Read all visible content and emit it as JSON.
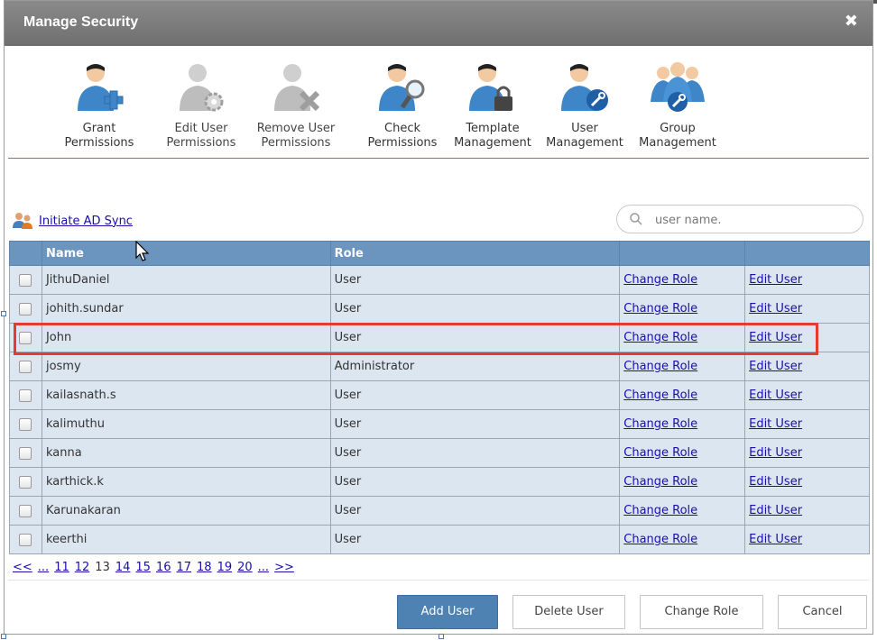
{
  "dialog": {
    "title": "Manage Security",
    "close_icon": "close-icon"
  },
  "toolbar": {
    "items": [
      {
        "label1": "Grant",
        "label2": "Permissions",
        "icon": "user-add-icon"
      },
      {
        "label1": "Edit User",
        "label2": "Permissions",
        "icon": "user-gear-icon"
      },
      {
        "label1": "Remove User",
        "label2": "Permissions",
        "icon": "user-remove-icon"
      },
      {
        "label1": "Check",
        "label2": "Permissions",
        "icon": "user-search-icon"
      },
      {
        "label1": "Template",
        "label2": "Management",
        "icon": "user-lock-icon"
      },
      {
        "label1": "User",
        "label2": "Management",
        "icon": "user-wrench-icon"
      },
      {
        "label1": "Group",
        "label2": "Management",
        "icon": "group-wrench-icon"
      }
    ]
  },
  "ad_sync": {
    "label": "Initiate AD Sync"
  },
  "search": {
    "placeholder": "user name."
  },
  "table": {
    "headers": [
      "",
      "Name",
      "Role",
      "",
      ""
    ],
    "rows": [
      {
        "name": "JithuDaniel",
        "role": "User",
        "change": "Change Role",
        "edit": "Edit User"
      },
      {
        "name": "johith.sundar",
        "role": "User",
        "change": "Change Role",
        "edit": "Edit User"
      },
      {
        "name": "John",
        "role": "User",
        "change": "Change Role",
        "edit": "Edit User"
      },
      {
        "name": "josmy",
        "role": "Administrator",
        "change": "Change Role",
        "edit": "Edit User"
      },
      {
        "name": "kailasnath.s",
        "role": "User",
        "change": "Change Role",
        "edit": "Edit User"
      },
      {
        "name": "kalimuthu",
        "role": "User",
        "change": "Change Role",
        "edit": "Edit User"
      },
      {
        "name": "kanna",
        "role": "User",
        "change": "Change Role",
        "edit": "Edit User"
      },
      {
        "name": "karthick.k",
        "role": "User",
        "change": "Change Role",
        "edit": "Edit User"
      },
      {
        "name": "Karunakaran",
        "role": "User",
        "change": "Change Role",
        "edit": "Edit User"
      },
      {
        "name": "keerthi",
        "role": "User",
        "change": "Change Role",
        "edit": "Edit User"
      }
    ]
  },
  "pager": {
    "first": "<<",
    "prev_ellipsis": "...",
    "pages": [
      "11",
      "12",
      "13",
      "14",
      "15",
      "16",
      "17",
      "18",
      "19",
      "20"
    ],
    "current": "13",
    "next_ellipsis": "...",
    "last": ">>"
  },
  "buttons": {
    "add_user": "Add User",
    "delete_user": "Delete User",
    "change_role": "Change Role",
    "cancel": "Cancel"
  },
  "colors": {
    "header": "#6b95bf",
    "row": "#dce6f1",
    "primary_button": "#4d82b3",
    "highlight": "#e53935"
  }
}
